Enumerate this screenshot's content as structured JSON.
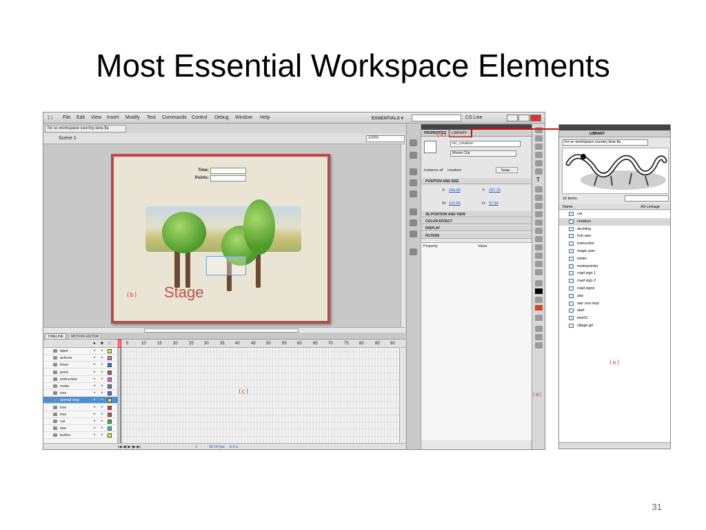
{
  "slide": {
    "title": "Most Essential Workspace Elements",
    "number": "31"
  },
  "menubar": {
    "app_icon": "Fl",
    "menus": [
      "File",
      "Edit",
      "View",
      "Insert",
      "Modify",
      "Text",
      "Commands",
      "Control",
      "Debug",
      "Window",
      "Help"
    ],
    "workspace": "ESSENTIALS ▾",
    "cs_live": "CS Live"
  },
  "document": {
    "tab": "for-sc-workspace-country-lane.fla",
    "scene": "Scene 1",
    "zoom": "100%"
  },
  "stage": {
    "time_label": "Time:",
    "points_label": "Points:",
    "label": "Stage",
    "marker": "(b)"
  },
  "timeline": {
    "tabs": [
      "TIMELINE",
      "MOTION EDITOR"
    ],
    "frame_numbers": [
      "5",
      "10",
      "15",
      "20",
      "25",
      "30",
      "35",
      "40",
      "45",
      "50",
      "55",
      "60",
      "65",
      "70",
      "75",
      "80",
      "85",
      "90"
    ],
    "layers": [
      {
        "name": "label",
        "color": "#f3ef4a"
      },
      {
        "name": "actions",
        "color": "#e06bd4"
      },
      {
        "name": "timer",
        "color": "#3b7fd6"
      },
      {
        "name": "point",
        "color": "#d64a3b"
      },
      {
        "name": "instruction",
        "color": "#e06bd4"
      },
      {
        "name": "meter",
        "color": "#7a7a7a"
      },
      {
        "name": "tree",
        "color": "#3b7fd6"
      },
      {
        "name": "animal sing",
        "color": "#f3ef4a"
      },
      {
        "name": "tree",
        "color": "#d64a3b"
      },
      {
        "name": "tree",
        "color": "#d64a3b"
      },
      {
        "name": "car",
        "color": "#4ab34a"
      },
      {
        "name": "star",
        "color": "#38c2e0"
      },
      {
        "name": "button",
        "color": "#f3ef4a"
      }
    ],
    "current_frame": "1",
    "fps": "30.00 fps",
    "time": "0.0 s",
    "marker": "(c)"
  },
  "properties": {
    "tabs": [
      "PROPERTIES",
      "LIBRARY"
    ],
    "instance_name": "inc_creature",
    "symbol_type": "Movie Clip",
    "instance_of_label": "Instance of:",
    "instance_of": "creature",
    "swap": "Swap...",
    "sections": [
      "POSITION AND SIZE",
      "3D POSITION AND VIEW",
      "COLOR EFFECT",
      "DISPLAY",
      "FILTERS"
    ],
    "x_label": "X:",
    "x": "294.50",
    "y_label": "Y:",
    "y": "297.75",
    "w_label": "W:",
    "w": "122.85",
    "h_label": "H:",
    "h": "57.60",
    "filter_cols": [
      "Property",
      "Value"
    ],
    "marker": "(d)"
  },
  "tools": {
    "text_tool": "T",
    "marker": "(a)",
    "stroke_color": "#000000",
    "fill_color": "#d6451e"
  },
  "library": {
    "tab": "LIBRARY",
    "document": "for-sc-workspace-country-lane.fla",
    "count": "16 items",
    "col_name": "Name",
    "col_linkage": "AS Linkage",
    "items": [
      "car",
      "creature",
      "duckling",
      "huh.wav",
      "instruction",
      "magic.wav",
      "meter",
      "meterpointer",
      "road sign 1",
      "road sign 2",
      "road signs",
      "star",
      "star one loop",
      "start",
      "tree01",
      "village.gif"
    ],
    "marker": "(e)"
  }
}
